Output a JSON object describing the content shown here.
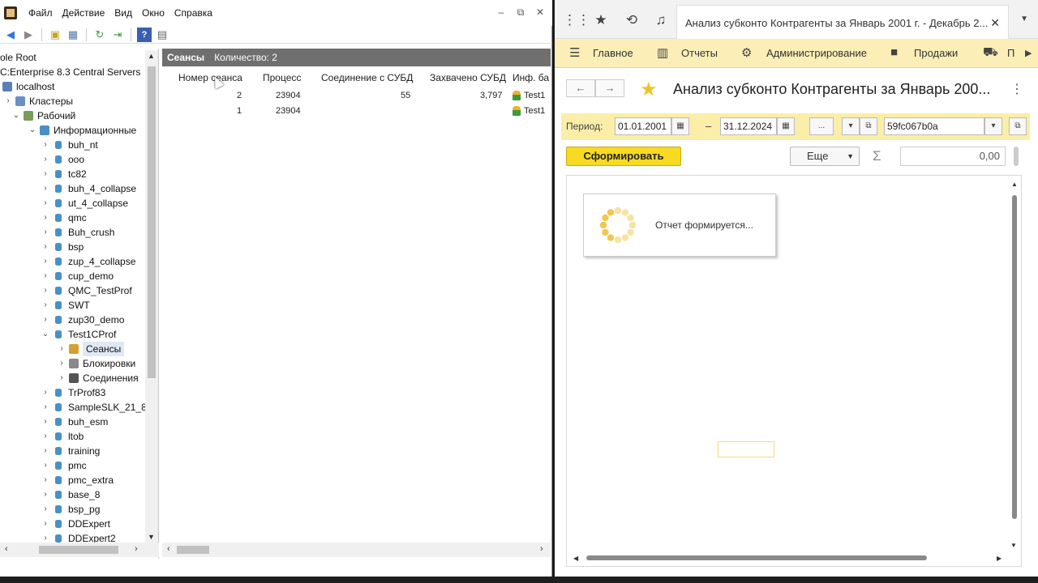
{
  "mmc": {
    "menu": [
      "Файл",
      "Действие",
      "Вид",
      "Окно",
      "Справка"
    ],
    "win_controls": [
      "–",
      "⧉",
      "✕"
    ],
    "tree": [
      {
        "label": "ole Root",
        "level": 0,
        "icon": "none",
        "chevron": ""
      },
      {
        "label": "C:Enterprise 8.3 Central Servers",
        "level": 0,
        "icon": "none",
        "chevron": ""
      },
      {
        "label": "localhost",
        "level": 0,
        "icon": "server",
        "chevron": ""
      },
      {
        "label": "Кластеры",
        "level": 1,
        "icon": "clusters",
        "chevron": "›"
      },
      {
        "label": "Рабочий",
        "level": 2,
        "icon": "cluster",
        "chevron": "⌄"
      },
      {
        "label": "Информационные",
        "level": 3,
        "icon": "infobases",
        "chevron": "⌄"
      },
      {
        "label": "buh_nt",
        "level": 4,
        "icon": "db",
        "chevron": "›"
      },
      {
        "label": "ooo",
        "level": 4,
        "icon": "db",
        "chevron": "›"
      },
      {
        "label": "tc82",
        "level": 4,
        "icon": "db",
        "chevron": "›"
      },
      {
        "label": "buh_4_collapse",
        "level": 4,
        "icon": "db",
        "chevron": "›"
      },
      {
        "label": "ut_4_collapse",
        "level": 4,
        "icon": "db",
        "chevron": "›"
      },
      {
        "label": "qmc",
        "level": 4,
        "icon": "db",
        "chevron": "›"
      },
      {
        "label": "Buh_crush",
        "level": 4,
        "icon": "db",
        "chevron": "›"
      },
      {
        "label": "bsp",
        "level": 4,
        "icon": "db",
        "chevron": "›"
      },
      {
        "label": "zup_4_collapse",
        "level": 4,
        "icon": "db",
        "chevron": "›"
      },
      {
        "label": "cup_demo",
        "level": 4,
        "icon": "db",
        "chevron": "›"
      },
      {
        "label": "QMC_TestProf",
        "level": 4,
        "icon": "db",
        "chevron": "›"
      },
      {
        "label": "SWT",
        "level": 4,
        "icon": "db",
        "chevron": "›"
      },
      {
        "label": "zup30_demo",
        "level": 4,
        "icon": "db",
        "chevron": "›"
      },
      {
        "label": "Test1CProf",
        "level": 4,
        "icon": "db",
        "chevron": "⌄"
      },
      {
        "label": "Сеансы",
        "level": 5,
        "icon": "sessions",
        "chevron": "›",
        "selected": true
      },
      {
        "label": "Блокировки",
        "level": 5,
        "icon": "locks",
        "chevron": "›"
      },
      {
        "label": "Соединения",
        "level": 5,
        "icon": "connections",
        "chevron": "›"
      },
      {
        "label": "TrProf83",
        "level": 4,
        "icon": "db",
        "chevron": "›"
      },
      {
        "label": "SampleSLK_21_8:",
        "level": 4,
        "icon": "db",
        "chevron": "›"
      },
      {
        "label": "buh_esm",
        "level": 4,
        "icon": "db",
        "chevron": "›"
      },
      {
        "label": "ltob",
        "level": 4,
        "icon": "db",
        "chevron": "›"
      },
      {
        "label": "training",
        "level": 4,
        "icon": "db",
        "chevron": "›"
      },
      {
        "label": "pmc",
        "level": 4,
        "icon": "db",
        "chevron": "›"
      },
      {
        "label": "pmc_extra",
        "level": 4,
        "icon": "db",
        "chevron": "›"
      },
      {
        "label": "base_8",
        "level": 4,
        "icon": "db",
        "chevron": "›"
      },
      {
        "label": "bsp_pg",
        "level": 4,
        "icon": "db",
        "chevron": "›"
      },
      {
        "label": "DDExpert",
        "level": 4,
        "icon": "db",
        "chevron": "›"
      },
      {
        "label": "DDExpert2",
        "level": 4,
        "icon": "db",
        "chevron": "›"
      }
    ],
    "list": {
      "title": "Сеансы",
      "count_label": "Количество: 2",
      "columns": [
        "Номер сеанса",
        "Процесс",
        "Соединение с СУБД",
        "Захвачено СУБД",
        "Инф. ба"
      ],
      "rows": [
        {
          "num": "2",
          "process": "23904",
          "dbconn": "55",
          "captured": "3,797",
          "infobase": "Test1"
        },
        {
          "num": "1",
          "process": "23904",
          "dbconn": "",
          "captured": "",
          "infobase": "Test1"
        }
      ]
    }
  },
  "onec": {
    "tab_title": "Анализ субконто Контрагенты за Январь 2001 г. - Декабрь 2...",
    "sections": [
      "Главное",
      "Отчеты",
      "Администрирование",
      "Продажи",
      "П"
    ],
    "form_title": "Анализ субконто Контрагенты за Январь 200...",
    "period_label": "Период:",
    "date_from": "01.01.2001",
    "date_to": "31.12.2024",
    "dash": "–",
    "ellipsis_btn": "...",
    "option_value": "59fc067b0a",
    "generate_label": "Сформировать",
    "more_label": "Еще",
    "sigma": "Σ",
    "sum_value": "0,00",
    "loading_text": "Отчет формируется...",
    "accent_color": "#f7da21",
    "section_bar_color": "#fbeeb7"
  }
}
